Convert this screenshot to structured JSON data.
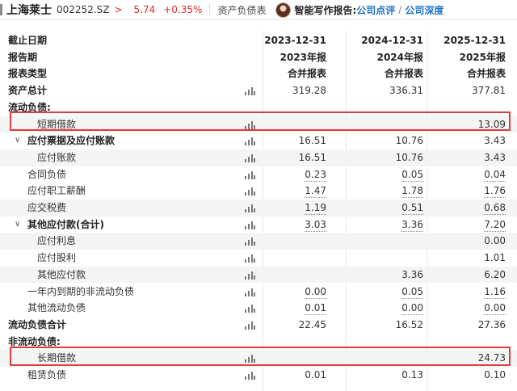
{
  "topbar": {
    "stock_name": "上海莱士",
    "stock_code": "002252.SZ",
    "price": "5.74",
    "change_pct": "+0.35%",
    "tab_label": "资产负债表",
    "ai_label": "智能写作报告:",
    "link_comment": "公司点评",
    "link_separator": "/",
    "link_depth": "公司深度"
  },
  "header_rows": [
    {
      "label": "截止日期",
      "cols": [
        "2023-12-31",
        "2024-12-31",
        "2025-12-31"
      ]
    },
    {
      "label": "报告期",
      "cols": [
        "2023年报",
        "2024年报",
        "2025年报"
      ]
    },
    {
      "label": "报表类型",
      "cols": [
        "合并报表",
        "合并报表",
        "合并报表"
      ]
    }
  ],
  "rows": [
    {
      "label": "资产总计",
      "values": [
        "319.28",
        "336.31",
        "377.81"
      ]
    },
    {
      "label": "流动负债:",
      "values": [
        "",
        "",
        ""
      ]
    },
    {
      "label": "短期借款",
      "values": [
        "",
        "",
        "13.09"
      ]
    },
    {
      "label": "应付票据及应付账款",
      "caret": "∨",
      "values": [
        "16.51",
        "10.76",
        "3.43"
      ]
    },
    {
      "label": "应付账款",
      "values": [
        "16.51",
        "10.76",
        "3.43"
      ]
    },
    {
      "label": "合同负债",
      "values": [
        "0.23",
        "0.05",
        "0.04"
      ]
    },
    {
      "label": "应付职工薪酬",
      "values": [
        "1.47",
        "1.78",
        "1.76"
      ]
    },
    {
      "label": "应交税费",
      "values": [
        "1.19",
        "0.51",
        "0.68"
      ]
    },
    {
      "label": "其他应付款(合计)",
      "caret": "∨",
      "values": [
        "3.03",
        "3.36",
        "7.20"
      ]
    },
    {
      "label": "应付利息",
      "values": [
        "",
        "",
        "0.00"
      ]
    },
    {
      "label": "应付股利",
      "values": [
        "",
        "",
        "1.01"
      ]
    },
    {
      "label": "其他应付款",
      "values": [
        "",
        "3.36",
        "6.20"
      ]
    },
    {
      "label": "一年内到期的非流动负债",
      "values": [
        "0.00",
        "0.05",
        "1.16"
      ]
    },
    {
      "label": "其他流动负债",
      "values": [
        "0.01",
        "0.00",
        "0.00"
      ]
    },
    {
      "label": "流动负债合计",
      "values": [
        "22.45",
        "16.52",
        "27.36"
      ]
    },
    {
      "label": "非流动负债:",
      "values": [
        "",
        "",
        ""
      ]
    },
    {
      "label": "长期借款",
      "values": [
        "",
        "",
        "24.73"
      ]
    },
    {
      "label": "租赁负债",
      "values": [
        "0.01",
        "0.13",
        "0.10"
      ]
    }
  ],
  "colors": {
    "up_red": "#e02828",
    "link_blue": "#1a73c9",
    "highlight_red": "#e03c3c",
    "row_shade": "#f4f4f4"
  },
  "icons": {
    "trend": "bar-chart-icon",
    "expand": "chevron-down-icon",
    "breadcrumb_arrow": "chevron-right-icon"
  }
}
